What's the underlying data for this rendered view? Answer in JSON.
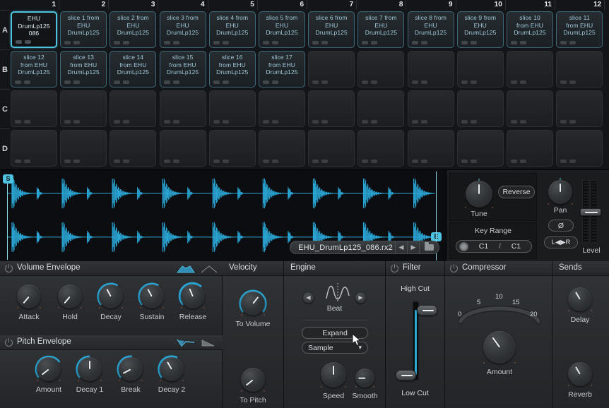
{
  "grid": {
    "columns": [
      "1",
      "2",
      "3",
      "4",
      "5",
      "6",
      "7",
      "8",
      "9",
      "10",
      "11",
      "12"
    ],
    "rows": [
      "A",
      "B",
      "C",
      "D"
    ],
    "pads": {
      "A": [
        {
          "label": "EHU\nDrumLp125\n086",
          "state": "selected"
        },
        {
          "label": "slice 1 from\nEHU\nDrumLp125",
          "state": "filled"
        },
        {
          "label": "slice 2 from\nEHU\nDrumLp125",
          "state": "filled"
        },
        {
          "label": "slice 3 from\nEHU\nDrumLp125",
          "state": "filled"
        },
        {
          "label": "slice 4 from\nEHU\nDrumLp125",
          "state": "filled"
        },
        {
          "label": "slice 5 from\nEHU\nDrumLp125",
          "state": "filled"
        },
        {
          "label": "slice 6 from\nEHU\nDrumLp125",
          "state": "filled"
        },
        {
          "label": "slice 7 from\nEHU\nDrumLp125",
          "state": "filled"
        },
        {
          "label": "slice 8 from\nEHU\nDrumLp125",
          "state": "filled"
        },
        {
          "label": "slice 9 from\nEHU\nDrumLp125",
          "state": "filled"
        },
        {
          "label": "slice 10\nfrom EHU\nDrumLp125",
          "state": "filled"
        },
        {
          "label": "slice 11\nfrom EHU\nDrumLp125",
          "state": "filled"
        }
      ],
      "B": [
        {
          "label": "slice 12\nfrom EHU\nDrumLp125",
          "state": "filled"
        },
        {
          "label": "slice 13\nfrom EHU\nDrumLp125",
          "state": "filled"
        },
        {
          "label": "slice 14\nfrom EHU\nDrumLp125",
          "state": "filled"
        },
        {
          "label": "slice 15\nfrom EHU\nDrumLp125",
          "state": "filled"
        },
        {
          "label": "slice 16\nfrom EHU\nDrumLp125",
          "state": "filled"
        },
        {
          "label": "slice 17\nfrom EHU\nDrumLp125",
          "state": "filled"
        },
        {
          "label": "",
          "state": "empty"
        },
        {
          "label": "",
          "state": "empty"
        },
        {
          "label": "",
          "state": "empty"
        },
        {
          "label": "",
          "state": "empty"
        },
        {
          "label": "",
          "state": "empty"
        },
        {
          "label": "",
          "state": "empty"
        }
      ],
      "C": [
        {
          "label": "",
          "state": "empty"
        },
        {
          "label": "",
          "state": "empty"
        },
        {
          "label": "",
          "state": "empty"
        },
        {
          "label": "",
          "state": "empty"
        },
        {
          "label": "",
          "state": "empty"
        },
        {
          "label": "",
          "state": "empty"
        },
        {
          "label": "",
          "state": "empty"
        },
        {
          "label": "",
          "state": "empty"
        },
        {
          "label": "",
          "state": "empty"
        },
        {
          "label": "",
          "state": "empty"
        },
        {
          "label": "",
          "state": "empty"
        },
        {
          "label": "",
          "state": "empty"
        }
      ],
      "D": [
        {
          "label": "",
          "state": "empty"
        },
        {
          "label": "",
          "state": "empty"
        },
        {
          "label": "",
          "state": "empty"
        },
        {
          "label": "",
          "state": "empty"
        },
        {
          "label": "",
          "state": "empty"
        },
        {
          "label": "",
          "state": "empty"
        },
        {
          "label": "",
          "state": "empty"
        },
        {
          "label": "",
          "state": "empty"
        },
        {
          "label": "",
          "state": "empty"
        },
        {
          "label": "",
          "state": "empty"
        },
        {
          "label": "",
          "state": "empty"
        },
        {
          "label": "",
          "state": "empty"
        }
      ]
    }
  },
  "waveform": {
    "start_marker": "S",
    "end_marker": "E",
    "waveform_color": "#2ba7d6",
    "background": "#0b0d10",
    "file_name": "EHU_DrumLp125_086.rx2",
    "prev_label": "◀",
    "next_label": "▶",
    "browse_icon": "folder-icon"
  },
  "sample_panel": {
    "tune": {
      "label": "Tune",
      "angle": 0
    },
    "reverse_button": "Reverse",
    "key_range": {
      "title": "Key Range",
      "low": "C1",
      "separator": "/",
      "high": "C1",
      "picker_icon": "keyboard-icon"
    },
    "pan": {
      "label": "Pan",
      "angle": 0
    },
    "phase_button": "Ø",
    "swap_button": "L◀▶R",
    "level": {
      "label": "Level",
      "value_pct": 55
    }
  },
  "modules": {
    "volume_envelope": {
      "title": "Volume Envelope",
      "power": true,
      "mode_icons": [
        "ahdsr-envelope-icon",
        "ad-envelope-icon"
      ],
      "selected_mode": 0,
      "knobs": [
        {
          "label": "Attack",
          "angle": -140,
          "ring": 0
        },
        {
          "label": "Hold",
          "angle": -140,
          "ring": 0
        },
        {
          "label": "Decay",
          "angle": -28,
          "ring": 62
        },
        {
          "label": "Sustain",
          "angle": -28,
          "ring": 62
        },
        {
          "label": "Release",
          "angle": -22,
          "ring": 66
        }
      ]
    },
    "pitch_envelope": {
      "title": "Pitch Envelope",
      "power": true,
      "mode_icons": [
        "pitch-env-down-icon",
        "pitch-env-ramp-icon"
      ],
      "selected_mode": 0,
      "knobs": [
        {
          "label": "Amount",
          "angle": -128,
          "ring": 72
        },
        {
          "label": "Decay 1",
          "angle": 0,
          "ring": 50
        },
        {
          "label": "Break",
          "angle": -118,
          "ring": 52
        },
        {
          "label": "Decay 2",
          "angle": -30,
          "ring": 60
        }
      ]
    },
    "velocity": {
      "title": "Velocity",
      "power": false,
      "knobs": [
        {
          "label": "To Volume",
          "angle": 38,
          "ring": 100
        },
        {
          "label": "To Pitch",
          "angle": -128,
          "ring": 0
        }
      ]
    },
    "engine": {
      "title": "Engine",
      "power": false,
      "mode_label": "Beat",
      "mode_icon": "waveform-beat-icon",
      "prev_label": "◀",
      "next_label": "▶",
      "expand_button": "Expand",
      "source_select": "Sample",
      "select_caret": "▾",
      "knobs": [
        {
          "label": "Speed",
          "angle": 0,
          "ring": 0
        },
        {
          "label": "Smooth",
          "angle": -90,
          "ring": 0
        }
      ]
    },
    "filter": {
      "title": "Filter",
      "power": true,
      "high_cut_label": "High Cut",
      "low_cut_label": "Low Cut",
      "high_cut_pct": 88,
      "low_cut_pct": 6
    },
    "compressor": {
      "title": "Compressor",
      "power": true,
      "scale_ticks": [
        "0",
        "5",
        "10",
        "15",
        "20"
      ],
      "knob": {
        "label": "Amount",
        "angle": -36,
        "ring": 0
      }
    },
    "sends": {
      "title": "Sends",
      "power": false,
      "knobs": [
        {
          "label": "Delay",
          "angle": -30,
          "ring": 0
        },
        {
          "label": "Reverb",
          "angle": -30,
          "ring": 0
        }
      ]
    }
  },
  "colors": {
    "accent": "#2ba7d6",
    "accent_bright": "#4ec3e0",
    "panel_bg": "#2a2c2f",
    "grid_bg": "#141518",
    "text": "#c8cdd2"
  }
}
